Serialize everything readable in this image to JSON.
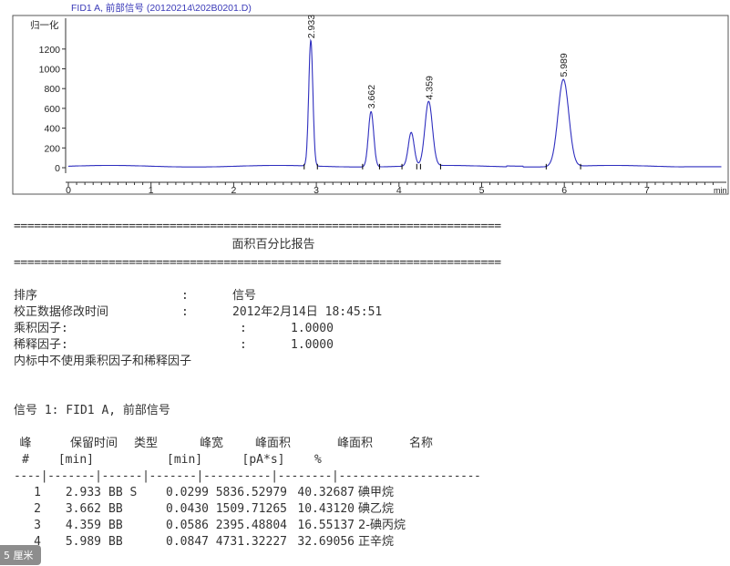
{
  "chart_data": {
    "type": "line",
    "title": "FID1 A, 前部信号 (20120214\\202B0201.D)",
    "ylabel": "归一化",
    "xlabel": "min",
    "xlim": [
      0,
      7.9
    ],
    "ylim": [
      -100,
      1450
    ],
    "x_ticks": [
      0,
      1,
      2,
      3,
      4,
      5,
      6,
      7
    ],
    "y_ticks": [
      0,
      200,
      400,
      600,
      800,
      1000,
      1200
    ],
    "peaks": [
      {
        "rt": 2.933,
        "height": 1270,
        "width": 0.025,
        "label": "2.933"
      },
      {
        "rt": 3.662,
        "height": 560,
        "width": 0.032,
        "label": "3.662"
      },
      {
        "rt": 4.148,
        "height": 340,
        "width": 0.035,
        "label": ""
      },
      {
        "rt": 4.359,
        "height": 650,
        "width": 0.045,
        "label": "4.359"
      },
      {
        "rt": 5.989,
        "height": 880,
        "width": 0.065,
        "label": "5.989"
      }
    ],
    "line_color": "#2f2fbf"
  },
  "report": {
    "rule": "========================================================================",
    "title": "面积百分比报告",
    "sort_label": "排序",
    "sort_value": "信号",
    "calib_label": "校正数据修改时间",
    "calib_value": "2012年2月14日 18:45:51",
    "mult_label": "乘积因子:",
    "mult_value": "1.0000",
    "dil_label": "稀释因子:",
    "dil_value": "1.0000",
    "note": "内标中不使用乘积因子和稀释因子",
    "signal_line": "信号 1: FID1 A, 前部信号",
    "colon": ":",
    "headers1": [
      "峰",
      "保留时间",
      "类型",
      "峰宽",
      "峰面积",
      "峰面积",
      "名称"
    ],
    "headers2": [
      "#",
      "[min]",
      "",
      "[min]",
      "[pA*s]",
      "%",
      ""
    ],
    "separator": "----|-------|------|-------|----------|--------|---------------------",
    "rows": [
      [
        "1",
        "2.933",
        "BB S",
        "0.0299",
        "5836.52979",
        "40.32687",
        "碘甲烷"
      ],
      [
        "2",
        "3.662",
        "BB",
        "0.0430",
        "1509.71265",
        "10.43120",
        "碘乙烷"
      ],
      [
        "3",
        "4.359",
        "BB",
        "0.0586",
        "2395.48804",
        "16.55137",
        "2-碘丙烷"
      ],
      [
        "4",
        "5.989",
        "BB",
        "0.0847",
        "4731.32227",
        "32.69056",
        "正辛烷"
      ]
    ]
  },
  "watermark": "5 厘米"
}
